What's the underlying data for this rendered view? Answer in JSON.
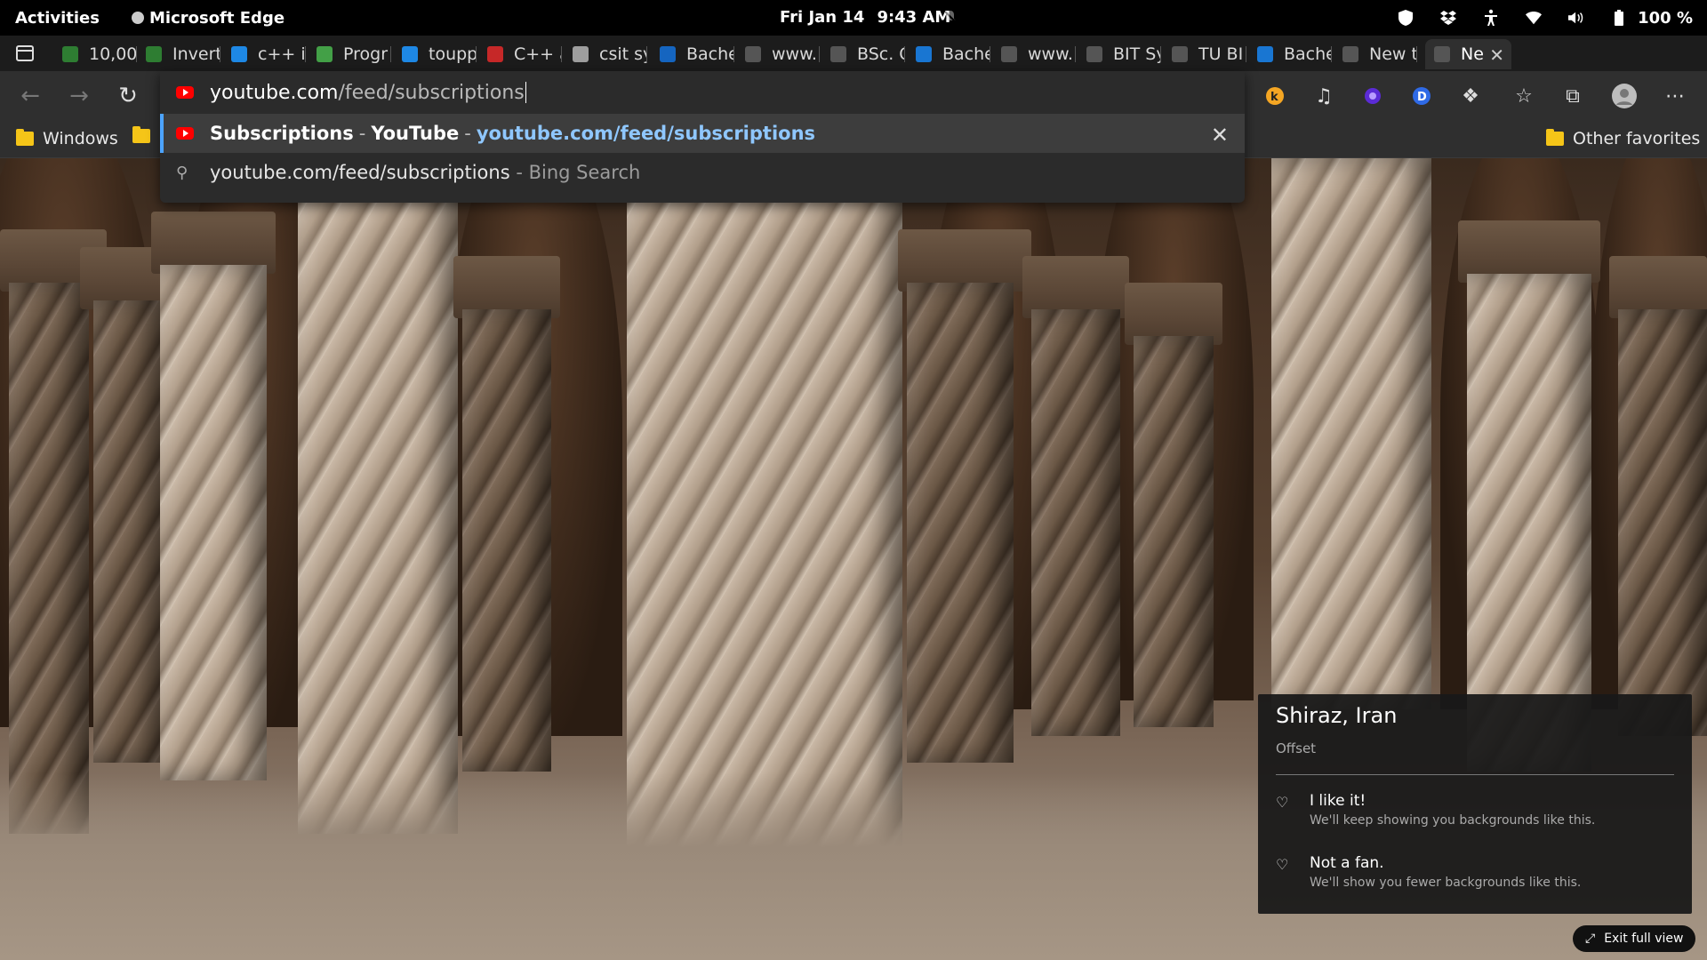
{
  "topbar": {
    "activities": "Activities",
    "app_name": "Microsoft Edge",
    "date": "Fri Jan 14",
    "time": "9:43 AM",
    "battery": "100 %"
  },
  "tabs": [
    {
      "label": "10,00",
      "fav_color": "#2e7d32"
    },
    {
      "label": "Invert",
      "fav_color": "#2e7d32"
    },
    {
      "label": "c++ is",
      "fav_color": "#1e88e5"
    },
    {
      "label": "Progr",
      "fav_color": "#43a047"
    },
    {
      "label": "toupp",
      "fav_color": "#1e88e5"
    },
    {
      "label": "C++ a",
      "fav_color": "#c62828"
    },
    {
      "label": "csit sy",
      "fav_color": "#9e9e9e"
    },
    {
      "label": "Bache",
      "fav_color": "#1565c0"
    },
    {
      "label": "www.",
      "fav_color": "#555555"
    },
    {
      "label": "BSc. C",
      "fav_color": "#555555"
    },
    {
      "label": "Bache",
      "fav_color": "#1976d2"
    },
    {
      "label": "www.",
      "fav_color": "#555555"
    },
    {
      "label": "BIT Sy",
      "fav_color": "#555555"
    },
    {
      "label": "TU BI",
      "fav_color": "#555555"
    },
    {
      "label": "Bache",
      "fav_color": "#1976d2"
    },
    {
      "label": "New t",
      "fav_color": "#555555"
    },
    {
      "label": "Ne",
      "fav_color": "#555555"
    }
  ],
  "omnibox": {
    "typed_host": "youtube.com",
    "typed_path": "/feed/subscriptions",
    "suggestion_title": "Subscriptions",
    "suggestion_site": "YouTube",
    "suggestion_sep": "-",
    "suggestion_url": "youtube.com/feed/subscriptions",
    "bing_query": "youtube.com/feed/subscriptions",
    "bing_suffix": "- Bing Search"
  },
  "bookmarks": {
    "windows": "Windows",
    "other": "Other favorites"
  },
  "info_card": {
    "location": "Shiraz, Iran",
    "credit": "Offset",
    "like_title": "I like it!",
    "like_sub": "We'll keep showing you backgrounds like this.",
    "dislike_title": "Not a fan.",
    "dislike_sub": "We'll show you fewer backgrounds like this."
  },
  "exit_full": "Exit full view",
  "colors": {
    "accent": "#4ca4ff",
    "youtube": "#ff0000",
    "folder": "#f5c518"
  }
}
